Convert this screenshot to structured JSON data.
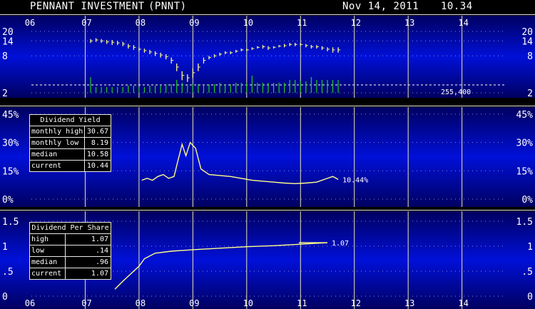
{
  "header": {
    "name": "PENNANT INVESTMENT",
    "ticker": "(PNNT)",
    "date": "Nov 14, 2011",
    "price": "10.34"
  },
  "colors": {
    "panel_edge": "#000060",
    "panel_mid": "#0010d8",
    "line": "#ffff88",
    "volume": "#22cc22",
    "grid": "#e8e8b0",
    "text": "#ffffff"
  },
  "dividend_yield_table": {
    "title": "Dividend Yield",
    "rows": [
      {
        "label": "monthly high",
        "value": "30.67"
      },
      {
        "label": "monthly low",
        "value": "8.19"
      },
      {
        "label": "median",
        "value": "10.58"
      },
      {
        "label": "current",
        "value": "10.44"
      }
    ]
  },
  "dividend_per_share_table": {
    "title": "Dividend Per Share",
    "rows": [
      {
        "label": "high",
        "value": "1.07"
      },
      {
        "label": "low",
        "value": ".14"
      },
      {
        "label": "median",
        "value": ".96"
      },
      {
        "label": "current",
        "value": "1.07"
      }
    ]
  },
  "chart_data": [
    {
      "type": "bar",
      "title": "Price",
      "x_ticks": [
        "06",
        "07",
        "08",
        "09",
        "10",
        "11",
        "12",
        "13",
        "14"
      ],
      "x_tick_years": [
        2006,
        2007,
        2008,
        2009,
        2010,
        2011,
        2012,
        2013,
        2014
      ],
      "xlim": [
        2006.0,
        2014.8
      ],
      "y_ticks": [
        "20",
        "14",
        "8",
        "2"
      ],
      "y_tick_values": [
        20,
        14,
        8,
        2
      ],
      "yscale": "log",
      "ylim": [
        2,
        20
      ],
      "volume_label": "255,400",
      "series": [
        {
          "kind": "high-low-bars",
          "x": [
            2007.1,
            2007.2,
            2007.3,
            2007.4,
            2007.5,
            2007.6,
            2007.7,
            2007.8,
            2007.9,
            2008.0,
            2008.1,
            2008.2,
            2008.3,
            2008.4,
            2008.5,
            2008.6,
            2008.7,
            2008.8,
            2008.9,
            2009.0,
            2009.1,
            2009.2,
            2009.3,
            2009.4,
            2009.5,
            2009.6,
            2009.7,
            2009.8,
            2009.9,
            2010.0,
            2010.1,
            2010.2,
            2010.3,
            2010.4,
            2010.5,
            2010.6,
            2010.7,
            2010.8,
            2010.9,
            2011.0,
            2011.1,
            2011.2,
            2011.3,
            2011.4,
            2011.5,
            2011.6,
            2011.7
          ],
          "high": [
            15,
            15.5,
            15,
            14.5,
            14.5,
            14,
            13.5,
            12.5,
            12,
            11,
            10.5,
            10,
            9.5,
            9,
            8.5,
            7.5,
            6,
            4.5,
            4,
            5,
            6,
            7.5,
            8,
            8.5,
            9,
            9.5,
            9.5,
            10,
            10.5,
            10.5,
            11,
            11.5,
            12,
            11.5,
            11.5,
            12,
            12.5,
            13,
            13,
            13,
            12.5,
            12,
            12,
            11.5,
            11,
            11,
            11
          ],
          "low": [
            13,
            13.5,
            13,
            12.5,
            12,
            12,
            11.5,
            10.5,
            10,
            9.5,
            9,
            8.5,
            8,
            7.5,
            7,
            6,
            4.5,
            3.2,
            3,
            3.5,
            4.5,
            6,
            7,
            7.5,
            8,
            8.5,
            8.5,
            9,
            9.5,
            9.5,
            10,
            10.5,
            10.5,
            10,
            10.5,
            11,
            11,
            11.5,
            11.5,
            11.5,
            11,
            10.5,
            10.5,
            10,
            9.5,
            9,
            9
          ]
        },
        {
          "kind": "volume",
          "x": [
            2007.1,
            2007.2,
            2007.3,
            2007.4,
            2007.5,
            2007.6,
            2007.7,
            2007.8,
            2007.9,
            2008.0,
            2008.1,
            2008.2,
            2008.3,
            2008.4,
            2008.5,
            2008.6,
            2008.7,
            2008.8,
            2008.9,
            2009.0,
            2009.1,
            2009.2,
            2009.3,
            2009.4,
            2009.5,
            2009.6,
            2009.7,
            2009.8,
            2009.9,
            2010.0,
            2010.1,
            2010.2,
            2010.3,
            2010.4,
            2010.5,
            2010.6,
            2010.7,
            2010.8,
            2010.9,
            2011.0,
            2011.1,
            2011.2,
            2011.3,
            2011.4,
            2011.5,
            2011.6,
            2011.7
          ],
          "values": [
            0.55,
            0.2,
            0.2,
            0.2,
            0.2,
            0.2,
            0.2,
            0.25,
            0.25,
            0.2,
            0.2,
            0.25,
            0.25,
            0.25,
            0.3,
            0.3,
            0.45,
            0.35,
            0.3,
            0.3,
            0.3,
            0.3,
            0.3,
            0.3,
            0.35,
            0.3,
            0.3,
            0.35,
            0.35,
            0.35,
            0.6,
            0.35,
            0.35,
            0.35,
            0.35,
            0.35,
            0.35,
            0.45,
            0.45,
            0.4,
            0.4,
            0.55,
            0.45,
            0.45,
            0.45,
            0.45,
            0.45
          ]
        }
      ]
    },
    {
      "type": "line",
      "title": "Dividend Yield",
      "x_ticks": [
        "06",
        "07",
        "08",
        "09",
        "10",
        "11",
        "12",
        "13",
        "14"
      ],
      "x_tick_years": [
        2006,
        2007,
        2008,
        2009,
        2010,
        2011,
        2012,
        2013,
        2014
      ],
      "xlim": [
        2006.0,
        2014.8
      ],
      "y_ticks": [
        "45%",
        "30%",
        "15%",
        "0%"
      ],
      "y_tick_values": [
        45,
        30,
        15,
        0
      ],
      "ylim": [
        0,
        45
      ],
      "end_label": "10.44%",
      "x": [
        2008.05,
        2008.15,
        2008.25,
        2008.35,
        2008.45,
        2008.55,
        2008.65,
        2008.72,
        2008.8,
        2008.87,
        2008.95,
        2009.05,
        2009.15,
        2009.3,
        2009.5,
        2009.7,
        2009.9,
        2010.1,
        2010.3,
        2010.5,
        2010.7,
        2010.9,
        2011.1,
        2011.3,
        2011.5,
        2011.6,
        2011.7
      ],
      "values": [
        10,
        11,
        10,
        12,
        13,
        11,
        12,
        20,
        29,
        23,
        30,
        27,
        16,
        13,
        12.5,
        12,
        11,
        10,
        9.5,
        9,
        8.5,
        8.2,
        8.5,
        9,
        11,
        12,
        10.44
      ]
    },
    {
      "type": "line",
      "title": "Dividend Per Share",
      "x_ticks": [
        "06",
        "07",
        "08",
        "09",
        "10",
        "11",
        "12",
        "13",
        "14"
      ],
      "x_tick_years": [
        2006,
        2007,
        2008,
        2009,
        2010,
        2011,
        2012,
        2013,
        2014
      ],
      "xlim": [
        2006.0,
        2014.8
      ],
      "y_ticks": [
        "1.5",
        "1",
        ".5",
        "0"
      ],
      "y_tick_values": [
        1.5,
        1,
        0.5,
        0
      ],
      "ylim": [
        0,
        1.5
      ],
      "end_label": "1.07",
      "x": [
        2007.55,
        2007.7,
        2007.85,
        2008.0,
        2008.1,
        2008.3,
        2008.6,
        2009.0,
        2009.5,
        2010.0,
        2010.5,
        2011.0,
        2011.5
      ],
      "values": [
        0.14,
        0.3,
        0.45,
        0.6,
        0.75,
        0.86,
        0.9,
        0.93,
        0.96,
        0.99,
        1.01,
        1.04,
        1.07
      ]
    }
  ]
}
